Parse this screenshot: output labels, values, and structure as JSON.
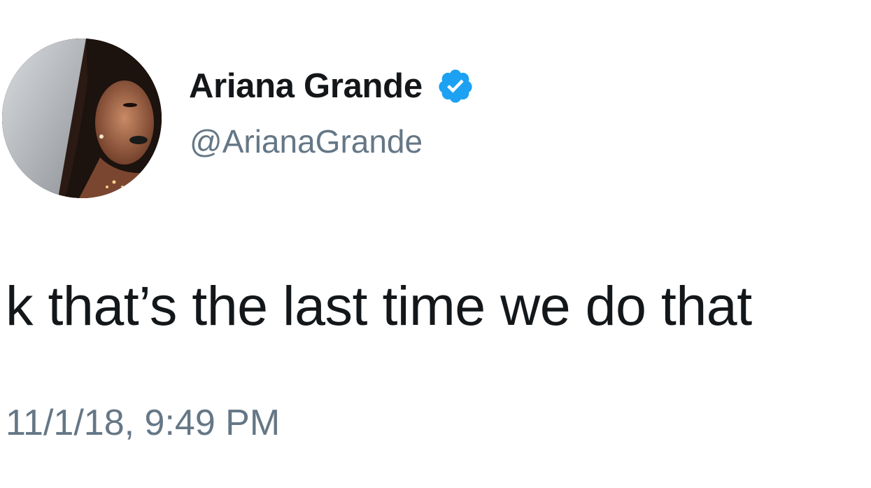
{
  "tweet": {
    "author": {
      "display_name": "Ariana Grande",
      "handle": "@ArianaGrande",
      "verified": true,
      "verified_icon": "verified-badge-icon",
      "verified_color": "#1da1f2",
      "avatar": "profile-photo"
    },
    "text": "k that’s the last time we do that",
    "timestamp": "11/1/18, 9:49 PM"
  },
  "colors": {
    "text_primary": "#14171a",
    "text_secondary": "#657786",
    "background": "#ffffff"
  }
}
